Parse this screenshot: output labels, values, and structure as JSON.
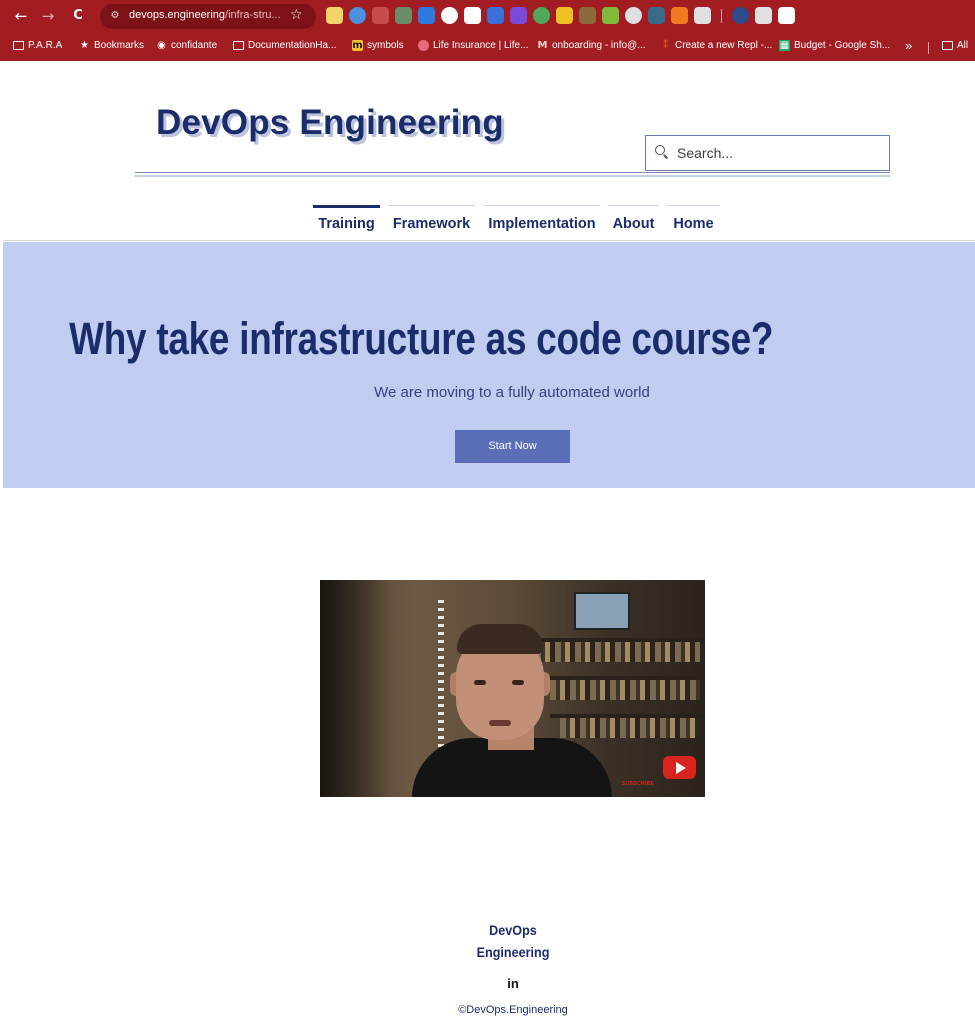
{
  "browser": {
    "nav": {
      "back_icon": "←",
      "forward_icon": "→",
      "reload_icon": "C"
    },
    "url": {
      "host": "devops.engineering",
      "path": "/infra-stru..."
    },
    "extension_colors": [
      "#f4d36b",
      "#4a8fe0",
      "#c94b4b",
      "#6a8a6a",
      "#2d7be0",
      "#ffffff",
      "#ffffff",
      "#3b6fd8",
      "#7a4ad8",
      "#4fa85a",
      "#f0c020",
      "#8a6a3a",
      "#7fba3a",
      "#e0e0e0",
      "#3a6a8a",
      "#f07a20",
      "#e0e0e0",
      "#2d4a8a",
      "#e0e0e0",
      "#ffffff"
    ],
    "bookmarks": [
      {
        "label": "P.A.R.A",
        "icon": "folder-icon"
      },
      {
        "label": "Bookmarks",
        "icon": "star-icon"
      },
      {
        "label": "confidante",
        "icon": "globe-icon"
      },
      {
        "label": "DocumentationHa...",
        "icon": "folder-icon"
      },
      {
        "label": "symbols",
        "icon": "miro-icon"
      },
      {
        "label": "Life Insurance | Life...",
        "icon": "site-icon"
      },
      {
        "label": "onboarding - info@...",
        "icon": "gmail-icon"
      },
      {
        "label": "Create a new Repl -...",
        "icon": "replit-icon"
      },
      {
        "label": "Budget - Google Sh...",
        "icon": "sheets-icon"
      }
    ],
    "overflow": "»",
    "all_bookmarks": "All"
  },
  "site": {
    "title": "DevOps Engineering",
    "search_placeholder": "Search...",
    "nav": [
      {
        "label": "Training",
        "active": true
      },
      {
        "label": "Framework",
        "active": false
      },
      {
        "label": "Implementation",
        "active": false
      },
      {
        "label": "About",
        "active": false
      },
      {
        "label": "Home",
        "active": false
      }
    ]
  },
  "hero": {
    "title": "Why take infrastructure as code course?",
    "subtitle": "We are moving to a fully automated world",
    "button": "Start Now",
    "background": "#c1ccf1",
    "button_color": "#5a6fb7"
  },
  "video": {
    "overlay_text": "SUBSCRIBE",
    "play_icon": "youtube-play-icon"
  },
  "footer": {
    "name_line1": "DevOps",
    "name_line2": "Engineering",
    "linkedin": "in",
    "copyright": "©DevOps.Engineering"
  },
  "colors": {
    "brand": "#1b2c6a",
    "chrome": "#a11d22"
  }
}
